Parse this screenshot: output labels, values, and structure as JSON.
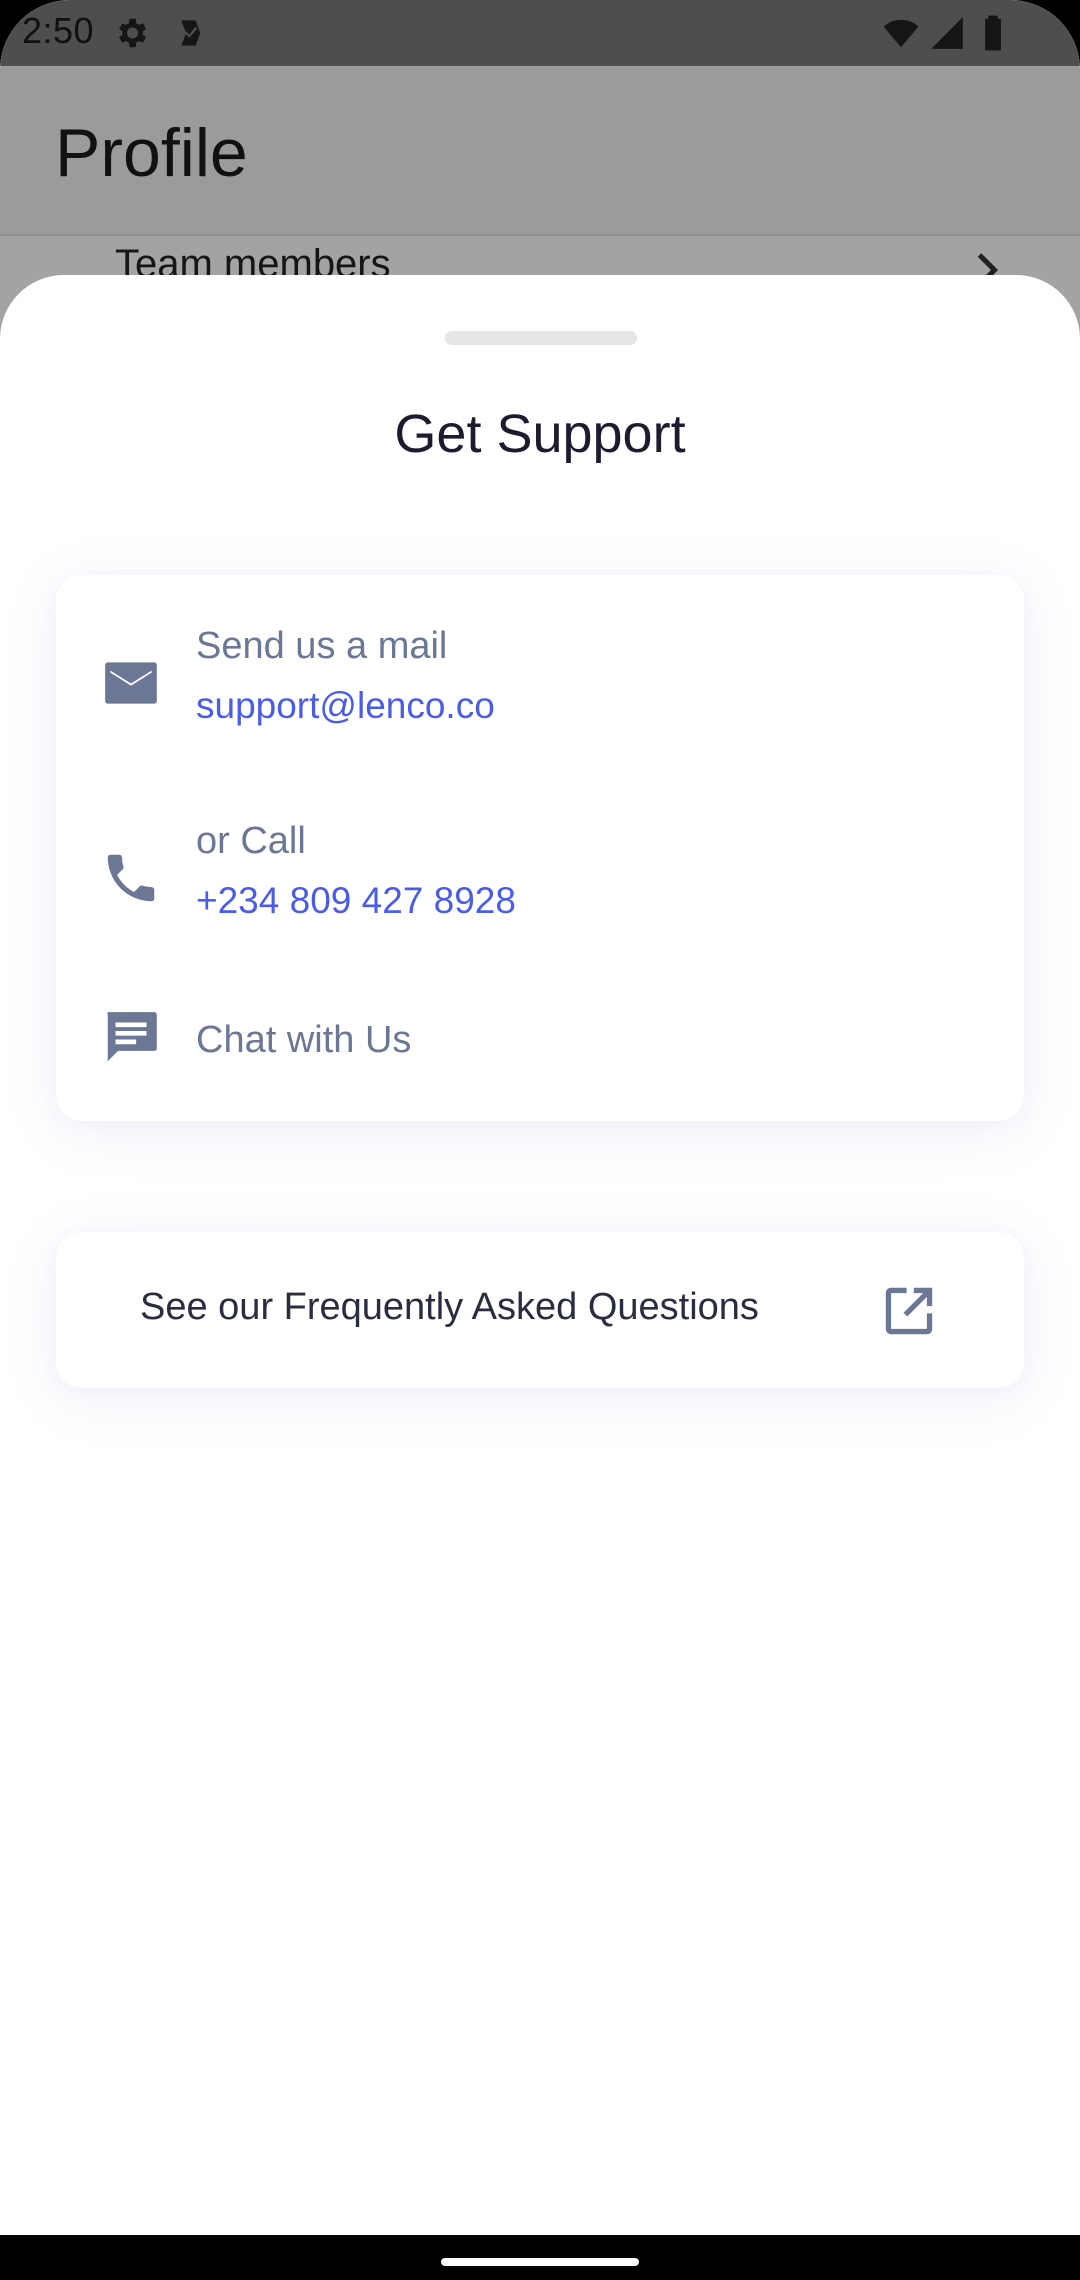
{
  "status_bar": {
    "time": "2:50",
    "left_icons": [
      "gear-icon",
      "checkbox-notification-icon"
    ],
    "right_icons": [
      "wifi-icon",
      "signal-icon",
      "battery-icon"
    ]
  },
  "background_page": {
    "title": "Profile",
    "row_label": "Team members"
  },
  "sheet": {
    "title": "Get Support",
    "contact": {
      "mail_label": "Send us a mail",
      "mail_value": "support@lenco.co",
      "call_label": "or Call",
      "call_value": "+234 809 427 8928",
      "chat_label": "Chat with Us"
    },
    "faq_label": "See our Frequently Asked Questions"
  },
  "colors": {
    "accent": "#4b5ce6",
    "icon": "#6b7794",
    "title": "#1d1b2e"
  }
}
